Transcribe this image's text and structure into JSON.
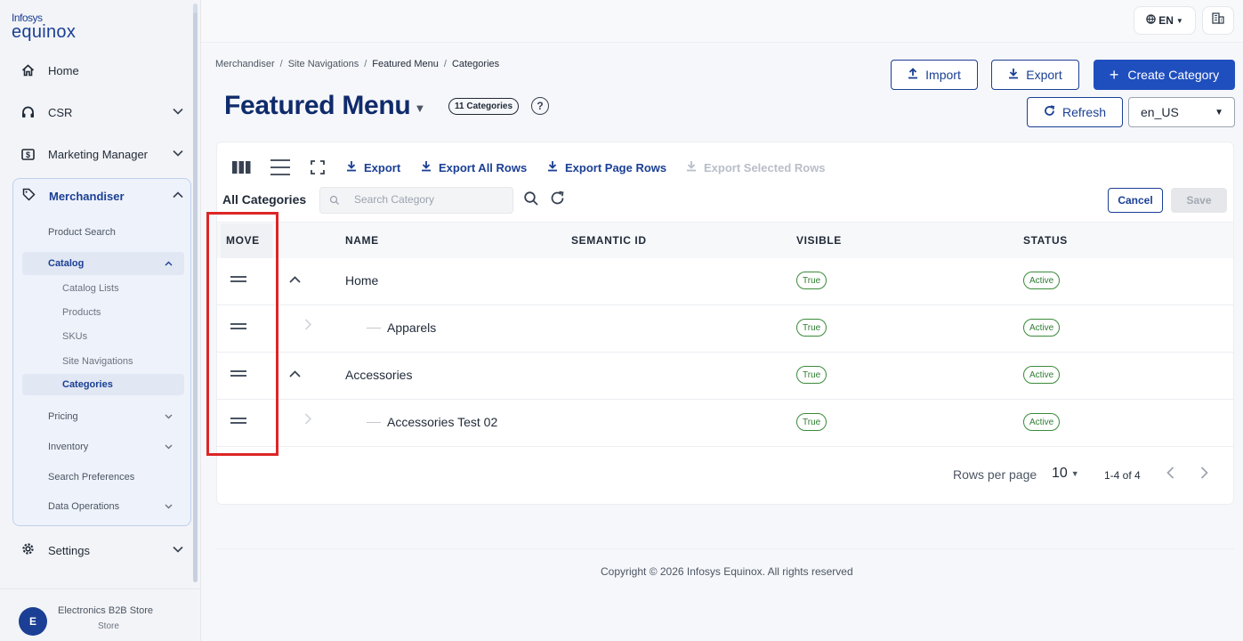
{
  "logo": {
    "line1": "Infosys",
    "line2": "equinox"
  },
  "sidebar": {
    "items": [
      {
        "label": "Home"
      },
      {
        "label": "CSR"
      },
      {
        "label": "Marketing Manager"
      },
      {
        "label": "Merchandiser"
      },
      {
        "label": "Settings"
      }
    ],
    "merchandiser": {
      "product_search": "Product Search",
      "catalog": "Catalog",
      "catalog_children": [
        "Catalog Lists",
        "Products",
        "SKUs",
        "Site Navigations",
        "Categories"
      ],
      "pricing": "Pricing",
      "inventory": "Inventory",
      "search_preferences": "Search Preferences",
      "data_operations": "Data Operations"
    },
    "store": {
      "initial": "E",
      "name": "Electronics B2B Store",
      "type": "Store"
    }
  },
  "header": {
    "language": "EN"
  },
  "breadcrumb": [
    "Merchandiser",
    "Site Navigations",
    "Featured Menu",
    "Categories"
  ],
  "page": {
    "title": "Featured Menu",
    "count_badge": "11 Categories",
    "help": "?"
  },
  "actions": {
    "import": "Import",
    "export": "Export",
    "create": "Create Category",
    "refresh": "Refresh",
    "locale": "en_US"
  },
  "toolbar": {
    "export": "Export",
    "export_all": "Export All Rows",
    "export_page": "Export Page Rows",
    "export_selected": "Export Selected Rows"
  },
  "table": {
    "title": "All Categories",
    "search_placeholder": "Search Category",
    "cancel": "Cancel",
    "save": "Save",
    "columns": [
      "MOVE",
      "NAME",
      "SEMANTIC ID",
      "VISIBLE",
      "STATUS"
    ],
    "rows": [
      {
        "name": "Home",
        "visible": "True",
        "status": "Active",
        "level": 0
      },
      {
        "name": "Apparels",
        "visible": "True",
        "status": "Active",
        "level": 1
      },
      {
        "name": "Accessories",
        "visible": "True",
        "status": "Active",
        "level": 0
      },
      {
        "name": "Accessories Test 02",
        "visible": "True",
        "status": "Active",
        "level": 1
      }
    ]
  },
  "pagination": {
    "rows_per_page_label": "Rows per page",
    "rows_per_page": "10",
    "range": "1-4 of 4"
  },
  "footer": {
    "copyright": "Copyright © 2026 Infosys Equinox. All rights reserved"
  },
  "colors": {
    "brand": "#1a3f94",
    "primary": "#1f4fbf",
    "success": "#2f7d32",
    "highlight": "#dc2626"
  }
}
